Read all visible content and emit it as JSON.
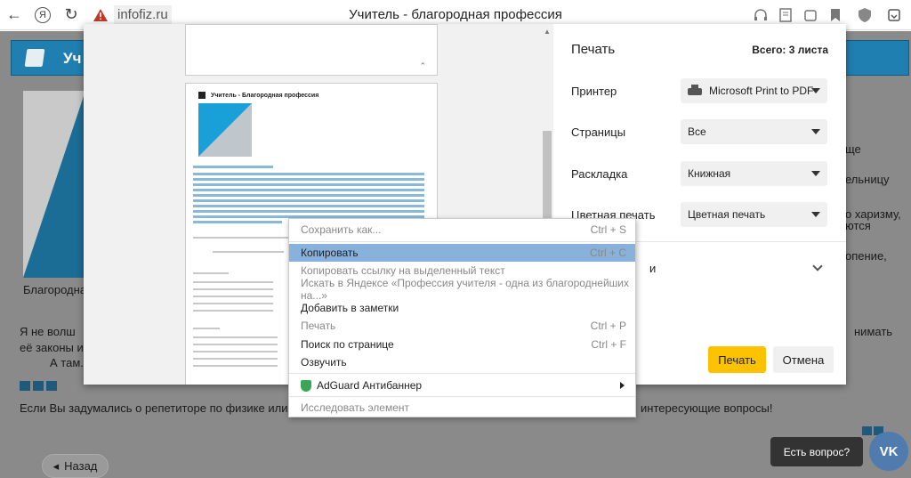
{
  "browser": {
    "domain": "infofiz.ru",
    "title": "Учитель - благородная профессия",
    "ya_letter": "Я"
  },
  "site": {
    "header_text": "Уч"
  },
  "background_text": {
    "caption": "Благородная",
    "line_a": "ще",
    "line_b": "ельницу",
    "line_c": "о харизму,",
    "line_d": "ются",
    "line_e": "опение,",
    "p1_start": "Я не волш",
    "p1_right": "нимать",
    "p2": "её законы и п",
    "p3": "А там...",
    "p4_left": "Если Вы задумались о репетиторе по физике или инф",
    "p4_right": "интересующие вопросы!",
    "back_label": "Назад"
  },
  "print_dialog": {
    "title": "Печать",
    "total": "Всего: 3 листа",
    "printer_label": "Принтер",
    "printer_value": "Microsoft Print to PDF",
    "pages_label": "Страницы",
    "pages_value": "Все",
    "layout_label": "Раскладка",
    "layout_value": "Книжная",
    "color_label": "Цветная печать",
    "color_value": "Цветная печать",
    "more_settings": "и",
    "print_button": "Печать",
    "cancel_button": "Отмена",
    "preview_title": "Учитель - Благородная профессия"
  },
  "context_menu": {
    "items": [
      {
        "label": "Сохранить как...",
        "shortcut": "Ctrl + S",
        "disabled": true
      },
      {
        "label": "Копировать",
        "shortcut": "Ctrl + C",
        "active": true
      },
      {
        "label": "Копировать ссылку на выделенный текст",
        "disabled": true
      },
      {
        "label": "Искать в Яндексе «Профессия учителя - одна из благороднейших на...»",
        "disabled": true
      },
      {
        "label": "Добавить в заметки"
      },
      {
        "label": "Печать",
        "shortcut": "Ctrl + P",
        "disabled": true
      },
      {
        "label": "Поиск по странице",
        "shortcut": "Ctrl + F"
      },
      {
        "label": "Озвучить"
      },
      {
        "label": "AdGuard Антибаннер"
      },
      {
        "label": "Исследовать элемент",
        "disabled": true
      }
    ]
  },
  "widget": {
    "tooltip": "Есть вопрос?",
    "vk_label": "VK"
  }
}
